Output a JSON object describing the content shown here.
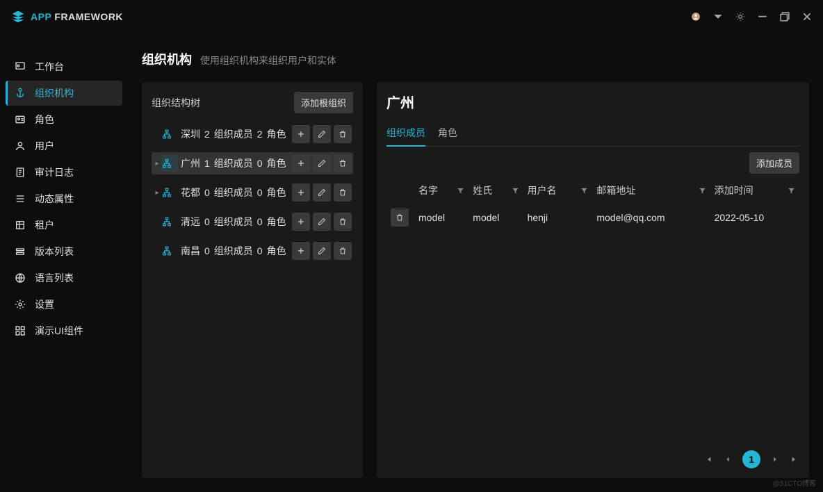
{
  "app": {
    "name_accent": "APP",
    "name_rest": " FRAMEWORK"
  },
  "sidebar": {
    "items": [
      {
        "label": "工作台",
        "icon": "dashboard"
      },
      {
        "label": "组织机构",
        "icon": "anchor"
      },
      {
        "label": "角色",
        "icon": "id-card"
      },
      {
        "label": "用户",
        "icon": "user"
      },
      {
        "label": "审计日志",
        "icon": "audit"
      },
      {
        "label": "动态属性",
        "icon": "list"
      },
      {
        "label": "租户",
        "icon": "tenant"
      },
      {
        "label": "版本列表",
        "icon": "versions"
      },
      {
        "label": "语言列表",
        "icon": "globe"
      },
      {
        "label": "设置",
        "icon": "gear"
      },
      {
        "label": "演示UI组件",
        "icon": "components"
      }
    ],
    "active_index": 1
  },
  "page": {
    "title": "组织机构",
    "description": "使用组织机构来组织用户和实体"
  },
  "tree": {
    "title": "组织结构树",
    "add_root_label": "添加根组织",
    "member_word": "组织成员",
    "role_word": "角色",
    "nodes": [
      {
        "name": "深圳",
        "members": 2,
        "roles": 2,
        "has_children": false
      },
      {
        "name": "广州",
        "members": 1,
        "roles": 0,
        "has_children": true
      },
      {
        "name": "花都",
        "members": 0,
        "roles": 0,
        "has_children": true
      },
      {
        "name": "清远",
        "members": 0,
        "roles": 0,
        "has_children": false
      },
      {
        "name": "南昌",
        "members": 0,
        "roles": 0,
        "has_children": false
      }
    ],
    "selected_index": 1
  },
  "detail": {
    "title": "广州",
    "tabs": [
      {
        "label": "组织成员"
      },
      {
        "label": "角色"
      }
    ],
    "active_tab": 0,
    "add_member_label": "添加成员",
    "columns": [
      {
        "label": "名字"
      },
      {
        "label": "姓氏"
      },
      {
        "label": "用户名"
      },
      {
        "label": "邮箱地址"
      },
      {
        "label": "添加时间"
      }
    ],
    "rows": [
      {
        "first_name": "model",
        "last_name": "model",
        "username": "henji",
        "email": "model@qq.com",
        "added": "2022-05-10"
      }
    ],
    "pager": {
      "current": "1"
    }
  },
  "watermark": "@51CTO博客"
}
